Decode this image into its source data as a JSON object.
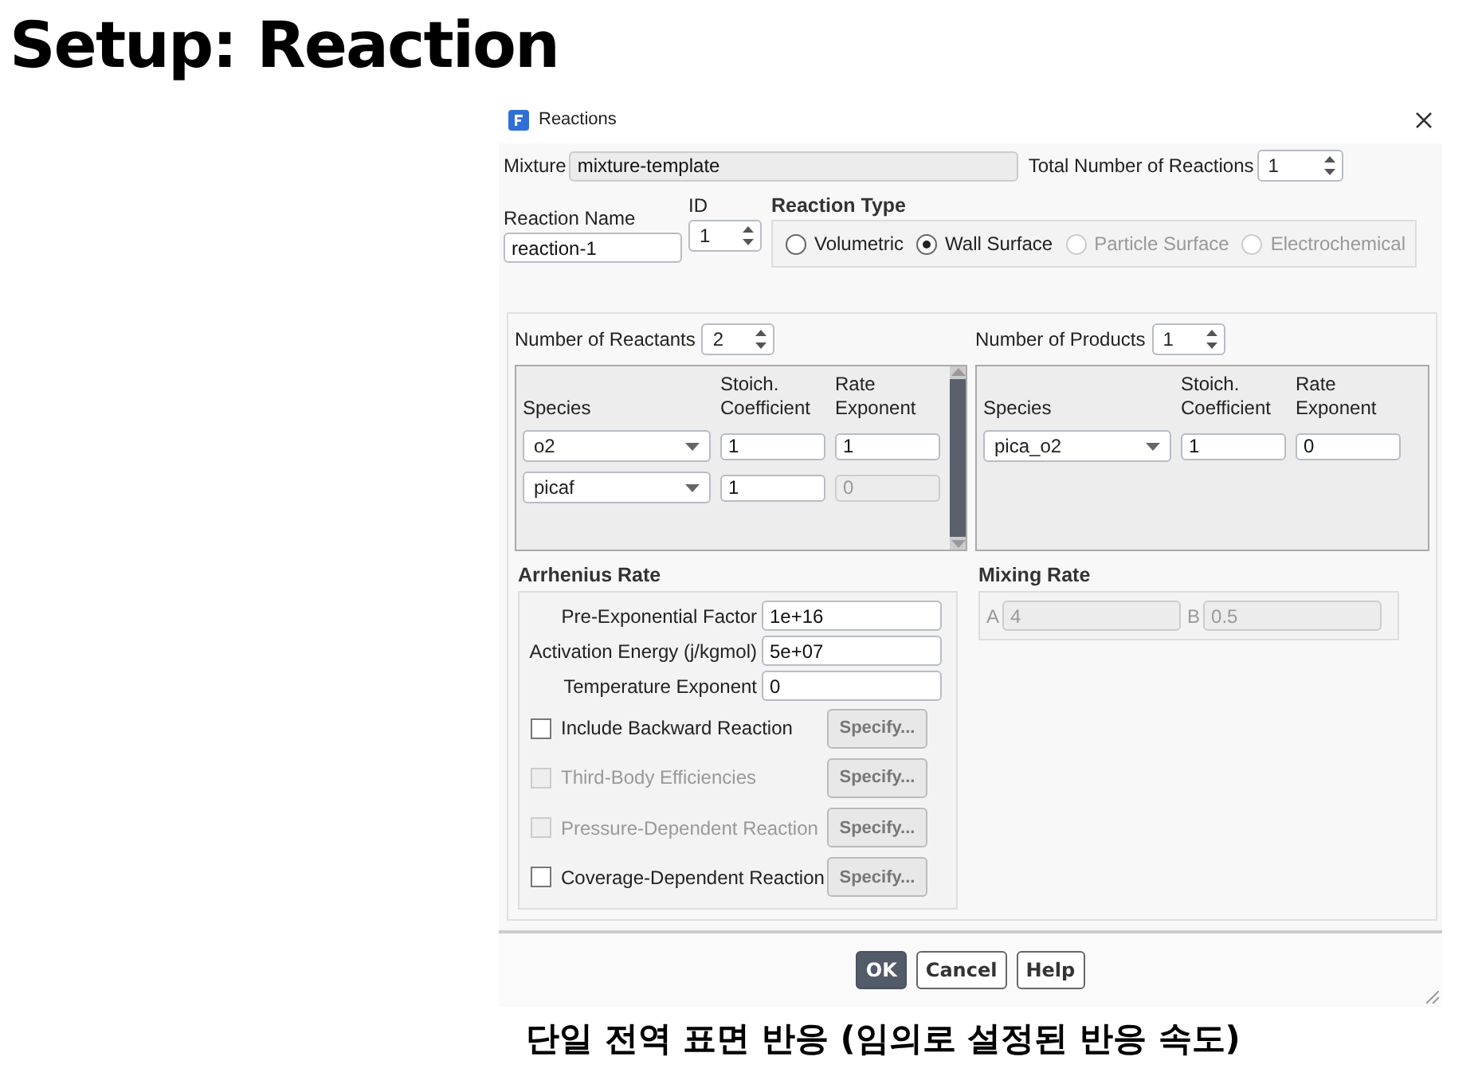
{
  "slide_title": "Setup: Reaction",
  "dialog": {
    "title": "Reactions"
  },
  "mixture": {
    "label": "Mixture",
    "value": "mixture-template",
    "disabled": true
  },
  "total_reactions": {
    "label": "Total Number of Reactions",
    "value": "1"
  },
  "reaction_name": {
    "label": "Reaction Name",
    "value": "reaction-1"
  },
  "reaction_id": {
    "label": "ID",
    "value": "1"
  },
  "reaction_type": {
    "label": "Reaction Type",
    "options": [
      {
        "label": "Volumetric",
        "selected": false,
        "disabled": false
      },
      {
        "label": "Wall Surface",
        "selected": true,
        "disabled": false
      },
      {
        "label": "Particle Surface",
        "selected": false,
        "disabled": true
      },
      {
        "label": "Electrochemical",
        "selected": false,
        "disabled": true
      }
    ]
  },
  "reactants": {
    "count_label": "Number of Reactants",
    "count": "2",
    "columns": [
      "Species",
      "Stoich. Coefficient",
      "Rate Exponent"
    ],
    "scrollbar": true,
    "rows": [
      {
        "species": "o2",
        "coefficient": "1",
        "exponent": "1",
        "exponent_disabled": false
      },
      {
        "species": "picaf",
        "coefficient": "1",
        "exponent": "0",
        "exponent_disabled": true
      }
    ]
  },
  "products": {
    "count_label": "Number of Products",
    "count": "1",
    "columns": [
      "Species",
      "Stoich. Coefficient",
      "Rate Exponent"
    ],
    "scrollbar": false,
    "rows": [
      {
        "species": "pica_o2",
        "coefficient": "1",
        "exponent": "0",
        "exponent_disabled": false
      }
    ]
  },
  "arrhenius": {
    "title": "Arrhenius Rate",
    "fields": [
      {
        "label": "Pre-Exponential Factor",
        "value": "1e+16"
      },
      {
        "label": "Activation Energy (j/kgmol)",
        "value": "5e+07"
      },
      {
        "label": "Temperature Exponent",
        "value": "0"
      }
    ],
    "options": [
      {
        "label": "Include Backward Reaction",
        "checked": false,
        "disabled": false,
        "button": "Specify..."
      },
      {
        "label": "Third-Body Efficiencies",
        "checked": false,
        "disabled": true,
        "button": "Specify..."
      },
      {
        "label": "Pressure-Dependent Reaction",
        "checked": false,
        "disabled": true,
        "button": "Specify..."
      },
      {
        "label": "Coverage-Dependent Reaction",
        "checked": false,
        "disabled": false,
        "button": "Specify..."
      }
    ]
  },
  "mixing_rate": {
    "title": "Mixing Rate",
    "disabled": true,
    "fields": [
      {
        "label": "A",
        "value": "4"
      },
      {
        "label": "B",
        "value": "0.5"
      }
    ]
  },
  "buttons": [
    {
      "label": "OK",
      "kind": "primary"
    },
    {
      "label": "Cancel",
      "kind": "normal"
    },
    {
      "label": "Help",
      "kind": "normal"
    }
  ],
  "caption": "단일 전역 표면 반응 (임의로 설정된 반응 속도)"
}
